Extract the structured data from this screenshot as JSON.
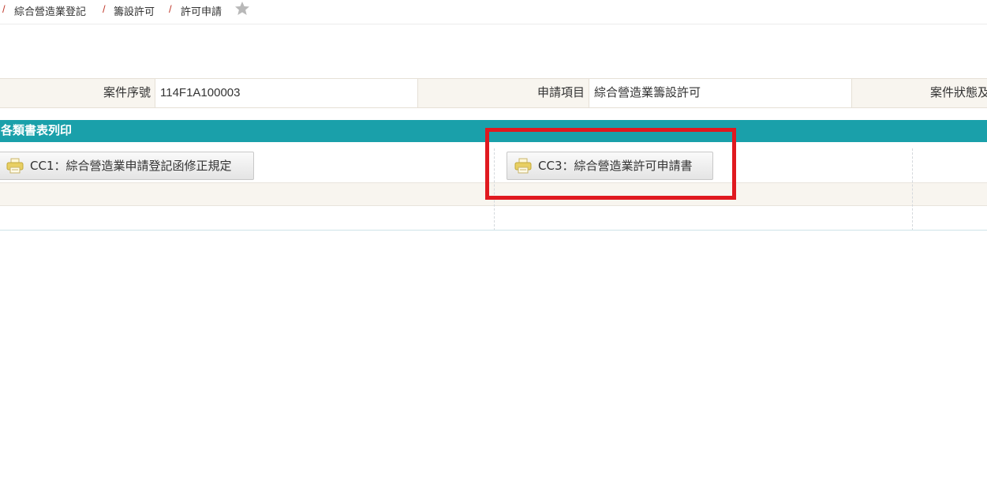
{
  "breadcrumb": {
    "separator": "/",
    "items": [
      "綜合營造業登記",
      "籌設許可",
      "許可申請"
    ],
    "favorite_icon": "star-icon"
  },
  "case_info": {
    "case_no_label": "案件序號",
    "case_no_value": "114F1A100003",
    "apply_item_label": "申請項目",
    "apply_item_value": "綜合營造業籌設許可",
    "status_label": "案件狀態及"
  },
  "print_section": {
    "title": "各類書表列印",
    "buttons": [
      {
        "label": "CC1：綜合營造業申請登記函修正規定",
        "icon": "printer-icon"
      },
      {
        "label": "CC3：綜合營造業許可申請書",
        "icon": "printer-icon"
      }
    ]
  },
  "colors": {
    "header_bg": "#1aa0aa",
    "label_bg": "#f8f5ef",
    "separator": "#c0392b",
    "highlight": "#e0191f"
  }
}
